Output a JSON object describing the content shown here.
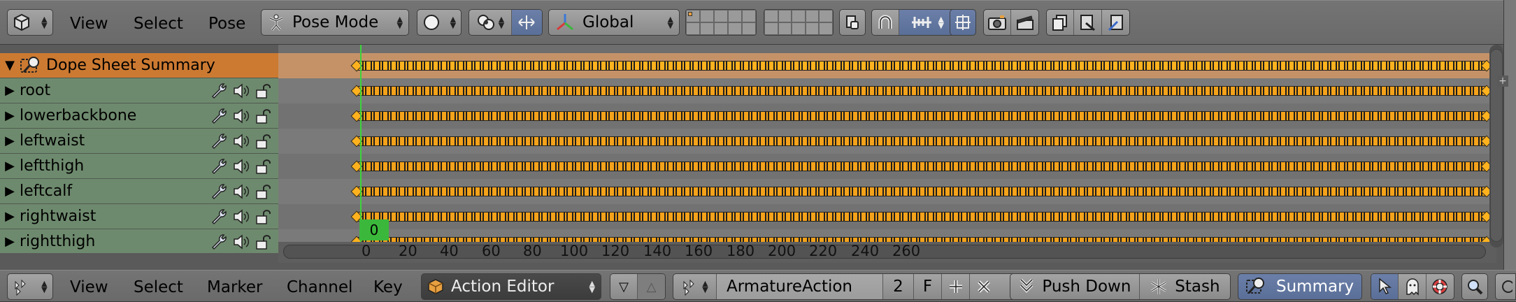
{
  "header": {
    "editor_type_icon": "cube-icon",
    "menus": [
      "View",
      "Select",
      "Pose"
    ],
    "mode": "Pose Mode",
    "orientation": "Global"
  },
  "channels": {
    "summary": "Dope Sheet Summary",
    "bones": [
      "root",
      "lowerbackbone",
      "leftwaist",
      "leftthigh",
      "leftcalf",
      "rightwaist",
      "rightthigh"
    ]
  },
  "timeline": {
    "current_frame": "0",
    "ticks": [
      "0",
      "20",
      "40",
      "60",
      "80",
      "100",
      "120",
      "140",
      "160",
      "180",
      "200",
      "220",
      "240",
      "260"
    ]
  },
  "footer": {
    "menus": [
      "View",
      "Select",
      "Marker",
      "Channel",
      "Key"
    ],
    "mode": "Action Editor",
    "action_name": "ArmatureAction",
    "users": "2",
    "fake_user": "F",
    "push_down": "Push Down",
    "stash": "Stash",
    "summary": "Summary"
  },
  "colors": {
    "summary_row": "#cc7a32",
    "bone_row": "#6e8a6e",
    "keyframe": "#f4a21a",
    "playhead": "#3bd43b"
  }
}
